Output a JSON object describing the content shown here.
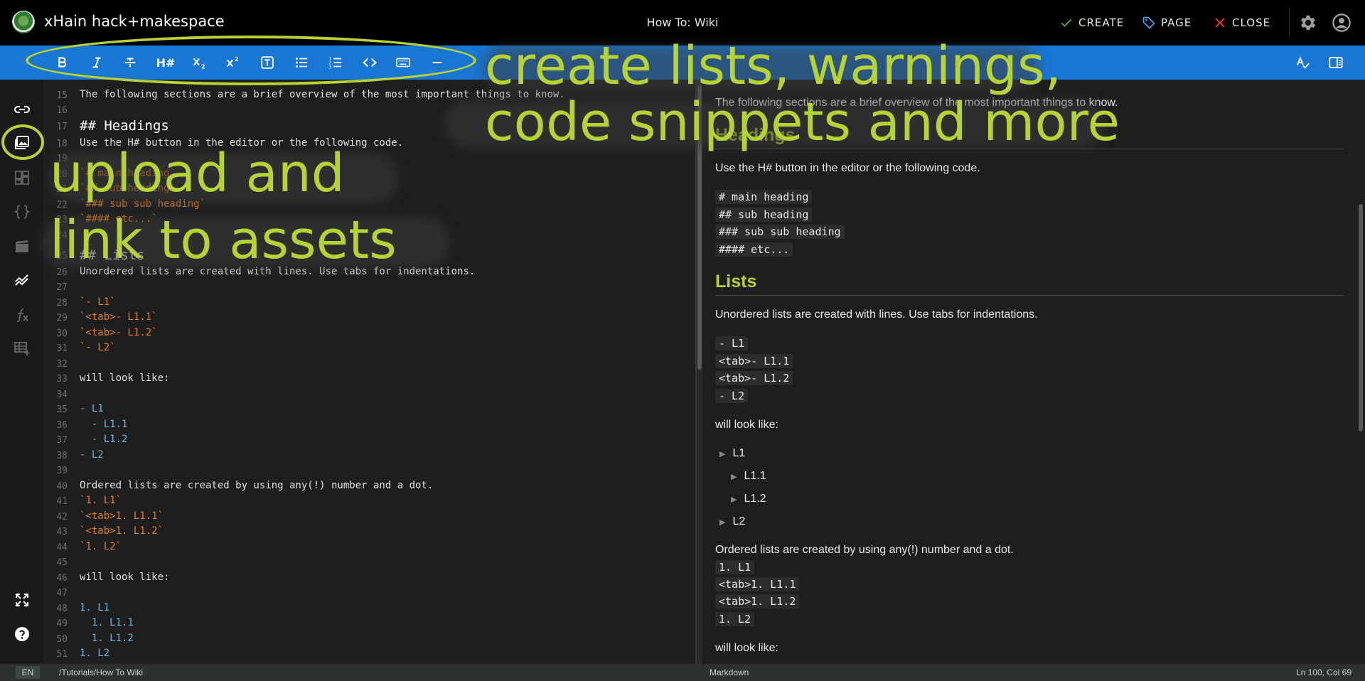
{
  "header": {
    "site_title": "xHain hack+makespace",
    "page_title": "How To: Wiki",
    "create_label": "CREATE",
    "page_label": "PAGE",
    "close_label": "CLOSE"
  },
  "toolbar": {
    "heading_label": "H#"
  },
  "editor": {
    "lines": [
      {
        "n": "15",
        "t": "The following sections are a brief overview of the most important things to know.",
        "k": "text"
      },
      {
        "n": "16",
        "t": "",
        "k": "text"
      },
      {
        "n": "17",
        "t": "## Headings",
        "k": "head"
      },
      {
        "n": "18",
        "t": "Use the H# button in the editor or the following code.",
        "k": "text"
      },
      {
        "n": "19",
        "t": "",
        "k": "text"
      },
      {
        "n": "20",
        "t": "`# main heading`",
        "k": "code"
      },
      {
        "n": "21",
        "t": "`## sub heading`",
        "k": "code"
      },
      {
        "n": "22",
        "t": "`### sub sub heading`",
        "k": "code"
      },
      {
        "n": "23",
        "t": "`#### etc...`",
        "k": "code"
      },
      {
        "n": "24",
        "t": "",
        "k": "text"
      },
      {
        "n": "25",
        "t": "## Lists",
        "k": "head"
      },
      {
        "n": "26",
        "t": "Unordered lists are created with lines. Use tabs for indentations.",
        "k": "text"
      },
      {
        "n": "27",
        "t": "",
        "k": "text"
      },
      {
        "n": "28",
        "t": "`- L1`",
        "k": "code"
      },
      {
        "n": "29",
        "t": "`<tab>- L1.1`",
        "k": "code"
      },
      {
        "n": "30",
        "t": "`<tab>- L1.2`",
        "k": "code"
      },
      {
        "n": "31",
        "t": "`- L2`",
        "k": "code"
      },
      {
        "n": "32",
        "t": "",
        "k": "text"
      },
      {
        "n": "33",
        "t": "will look like:",
        "k": "text"
      },
      {
        "n": "34",
        "t": "",
        "k": "text"
      },
      {
        "n": "35",
        "t": "- L1",
        "k": "list"
      },
      {
        "n": "36",
        "t": "  - L1.1",
        "k": "list"
      },
      {
        "n": "37",
        "t": "  - L1.2",
        "k": "list"
      },
      {
        "n": "38",
        "t": "- L2",
        "k": "list"
      },
      {
        "n": "39",
        "t": "",
        "k": "text"
      },
      {
        "n": "40",
        "t": "Ordered lists are created by using any(!) number and a dot.",
        "k": "text"
      },
      {
        "n": "41",
        "t": "`1. L1`",
        "k": "code"
      },
      {
        "n": "42",
        "t": "`<tab>1. L1.1`",
        "k": "code"
      },
      {
        "n": "43",
        "t": "`<tab>1. L1.2`",
        "k": "code"
      },
      {
        "n": "44",
        "t": "`1. L2`",
        "k": "code"
      },
      {
        "n": "45",
        "t": "",
        "k": "text"
      },
      {
        "n": "46",
        "t": "will look like:",
        "k": "text"
      },
      {
        "n": "47",
        "t": "",
        "k": "text"
      },
      {
        "n": "48",
        "t": "1. L1",
        "k": "list"
      },
      {
        "n": "49",
        "t": "  1. L1.1",
        "k": "list"
      },
      {
        "n": "50",
        "t": "  1. L1.2",
        "k": "list"
      },
      {
        "n": "51",
        "t": "1. L2",
        "k": "list"
      }
    ]
  },
  "preview": {
    "intro": "The following sections are a brief overview of the most important things to know.",
    "headings_title": "Headings",
    "headings_desc": "Use the H# button in the editor or the following code.",
    "heading_codes": [
      "# main heading",
      "## sub heading",
      "### sub sub heading",
      "#### etc..."
    ],
    "lists_title": "Lists",
    "lists_desc": "Unordered lists are created with lines. Use tabs for indentations.",
    "unordered_codes": [
      "- L1",
      "<tab>- L1.1",
      "<tab>- L1.2",
      "- L2"
    ],
    "look_like_1": "will look like:",
    "unordered_items": [
      {
        "text": "L1",
        "level": 0
      },
      {
        "text": "L1.1",
        "level": 1
      },
      {
        "text": "L1.2",
        "level": 1
      },
      {
        "text": "L2",
        "level": 0
      }
    ],
    "ordered_desc": "Ordered lists are created by using any(!) number and a dot.",
    "ordered_codes": [
      "1. L1",
      "<tab>1. L1.1",
      "<tab>1. L1.2",
      "1. L2"
    ],
    "look_like_2": "will look like:"
  },
  "statusbar": {
    "lang": "EN",
    "path": "/Tutorials/How To Wiki",
    "mode": "Markdown",
    "position": "Ln 100, Col 69"
  },
  "annotations": {
    "toolbar_callout_line1": "create lists, warnings,",
    "toolbar_callout_line2": "code snippets and more",
    "assets_callout_line1": "upload and",
    "assets_callout_line2": "link to assets"
  },
  "colors": {
    "header_bg": "#000000",
    "toolbar_bg": "#1976d2",
    "annotation": "#b5d334",
    "heading_accent": "#b5d334",
    "code_orange": "#e67e22",
    "list_blue": "#6fb3e0",
    "create_icon": "#4caf50",
    "page_icon": "#42a5f5",
    "close_icon": "#e53935"
  },
  "icons": {
    "create": "check-icon",
    "page": "tag-icon",
    "close": "close-icon",
    "settings": "gear-icon",
    "account": "account-circle-icon"
  }
}
